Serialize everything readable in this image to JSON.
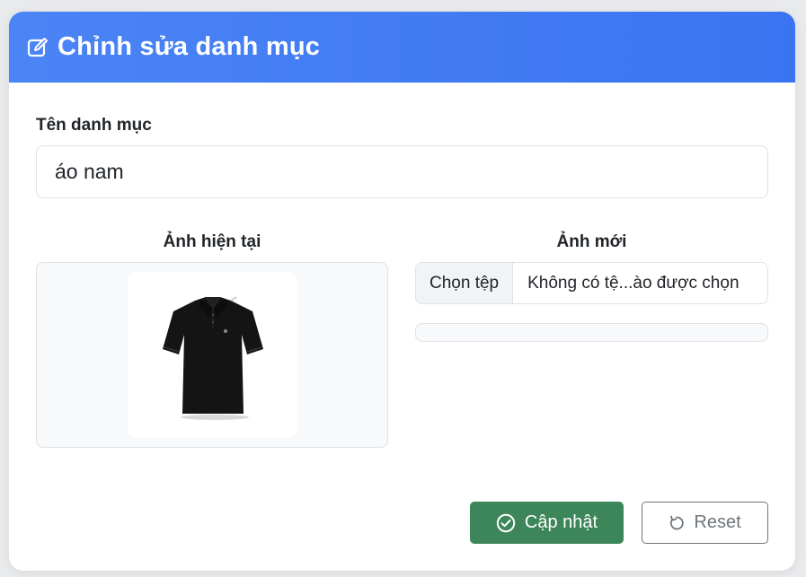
{
  "header": {
    "title": "Chỉnh sửa danh mục",
    "icon": "edit-icon",
    "color": "#3b74f2"
  },
  "form": {
    "name_label": "Tên danh mục",
    "name_value": "áo nam",
    "current_image_label": "Ảnh hiện tại",
    "current_image_alt": "black-polo-shirt",
    "new_image_label": "Ảnh mới",
    "file_button_label": "Chọn tệp",
    "file_status": "Không có tệ...ào được chọn"
  },
  "actions": {
    "update_label": "Cập nhật",
    "update_icon": "check-circle-icon",
    "update_color": "#3d8659",
    "reset_label": "Reset",
    "reset_icon": "reset-icon"
  }
}
